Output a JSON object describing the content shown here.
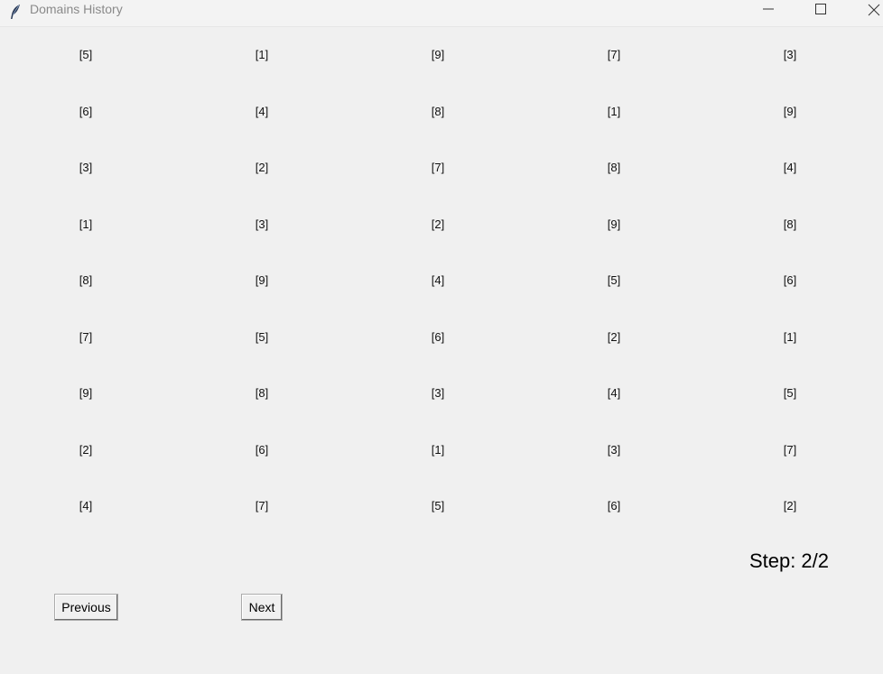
{
  "window": {
    "title": "Domains History",
    "icon": "feather-icon",
    "controls": [
      "minimize-icon",
      "maximize-icon",
      "close-icon"
    ]
  },
  "grid": {
    "rows": [
      [
        "[5]",
        "[1]",
        "[9]",
        "[7]",
        "[3]"
      ],
      [
        "[6]",
        "[4]",
        "[8]",
        "[1]",
        "[9]"
      ],
      [
        "[3]",
        "[2]",
        "[7]",
        "[8]",
        "[4]"
      ],
      [
        "[1]",
        "[3]",
        "[2]",
        "[9]",
        "[8]"
      ],
      [
        "[8]",
        "[9]",
        "[4]",
        "[5]",
        "[6]"
      ],
      [
        "[7]",
        "[5]",
        "[6]",
        "[2]",
        "[1]"
      ],
      [
        "[9]",
        "[8]",
        "[3]",
        "[4]",
        "[5]"
      ],
      [
        "[2]",
        "[6]",
        "[1]",
        "[3]",
        "[7]"
      ],
      [
        "[4]",
        "[7]",
        "[5]",
        "[6]",
        "[2]"
      ]
    ]
  },
  "status": {
    "step_text": "Step: 2/2"
  },
  "navigation": {
    "previous_label": "Previous",
    "next_label": "Next"
  }
}
